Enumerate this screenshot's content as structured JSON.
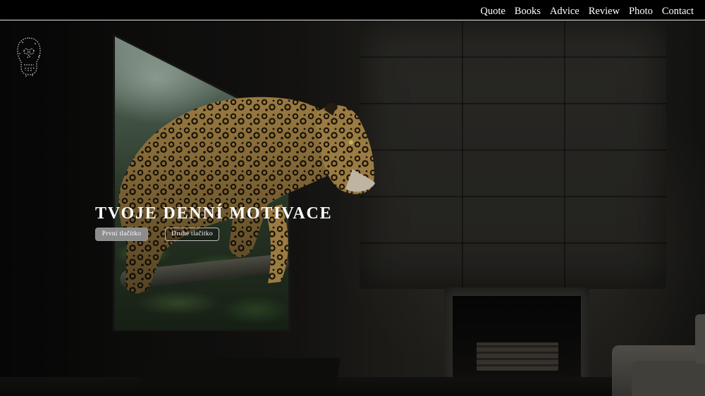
{
  "nav": {
    "items": [
      {
        "label": "Quote"
      },
      {
        "label": "Books"
      },
      {
        "label": "Advice"
      },
      {
        "label": "Review"
      },
      {
        "label": "Photo"
      },
      {
        "label": "Contact"
      }
    ]
  },
  "logo": {
    "icon": "skull-icon"
  },
  "hero": {
    "title": "TVOJE DENNÍ MOTIVACE",
    "primary_button": "První tlačítko",
    "secondary_button": "Druhé tlačítko",
    "background": "jaguar-leaping-from-tv-image"
  },
  "colors": {
    "nav_background": "#000000",
    "nav_text": "#ffffff",
    "primary_button": "#8c8c8c",
    "hero_text": "#ffffff"
  }
}
